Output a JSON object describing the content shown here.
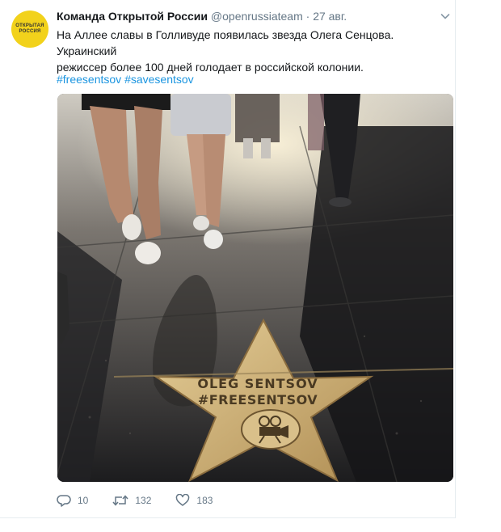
{
  "tweet": {
    "avatar_lines": [
      "ОТКРЫТАЯ",
      "РОССИЯ"
    ],
    "display_name": "Команда Открытой России",
    "handle": "@openrussiateam",
    "separator": "·",
    "date": "27 авг.",
    "text_line1": "На Аллее славы в Голливуде появилась звезда Олега Сенцова. Украинский",
    "text_line2": "режиссер более 100 дней голодает в российской колонии.",
    "hashtags": [
      "#freesentsov",
      "#savesentsov"
    ],
    "photo": {
      "star_line1": "OLEG  SENTSOV",
      "star_line2": "#FREESENTSOV"
    },
    "actions": {
      "replies": "10",
      "retweets": "132",
      "likes": "183"
    },
    "icons": {
      "reply": "reply-icon",
      "retweet": "retweet-icon",
      "like": "heart-icon",
      "menu": "chevron-down-icon",
      "emblem": "movie-camera-icon"
    },
    "colors": {
      "link": "#1b95e0",
      "secondary": "#657786",
      "avatar": "#f2d21b",
      "star": "#c9a96a"
    }
  }
}
